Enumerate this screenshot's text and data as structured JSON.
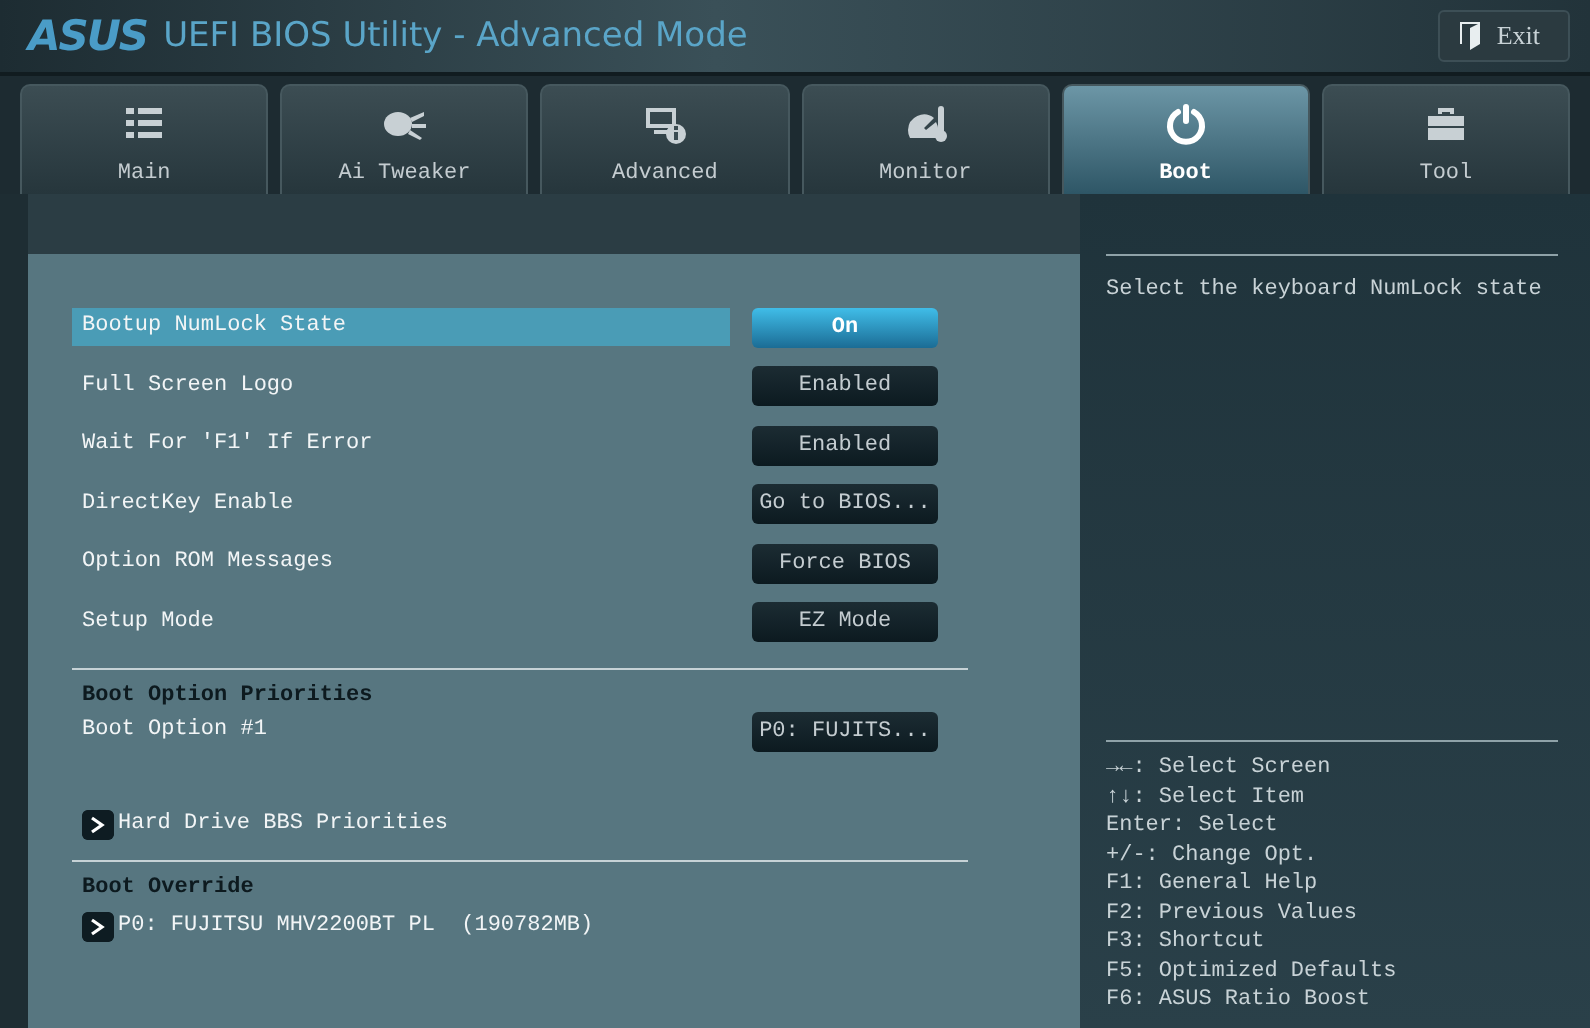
{
  "header": {
    "logo": "ASUS",
    "title": "UEFI BIOS Utility - Advanced Mode",
    "exit_label": "Exit"
  },
  "tabs": [
    {
      "label": "Main",
      "kind": "list",
      "selected": false
    },
    {
      "label": "Ai Tweaker",
      "kind": "fan",
      "selected": false
    },
    {
      "label": "Advanced",
      "kind": "monitor",
      "selected": false
    },
    {
      "label": "Monitor",
      "kind": "gauge",
      "selected": false
    },
    {
      "label": "Boot",
      "kind": "power",
      "selected": true
    },
    {
      "label": "Tool",
      "kind": "toolbox",
      "selected": false
    }
  ],
  "sections": [
    {
      "items": [
        {
          "kind": "option",
          "label": "Bootup NumLock State",
          "value": "On",
          "selected": true
        },
        {
          "kind": "option",
          "label": "Full Screen Logo",
          "value": "Enabled",
          "selected": false
        },
        {
          "kind": "option",
          "label": "Wait For 'F1' If Error",
          "value": "Enabled",
          "selected": false
        },
        {
          "kind": "option",
          "label": "DirectKey Enable",
          "value": "Go to BIOS...",
          "selected": false
        },
        {
          "kind": "option",
          "label": "Option ROM Messages",
          "value": "Force BIOS",
          "selected": false
        },
        {
          "kind": "option",
          "label": "Setup Mode",
          "value": "EZ Mode",
          "selected": false
        }
      ]
    },
    {
      "title": "Boot Option Priorities",
      "items": [
        {
          "kind": "option",
          "label": "Boot Option #1",
          "value": "P0: FUJITS...",
          "selected": false
        },
        {
          "kind": "submenu",
          "label": "Hard Drive BBS Priorities",
          "selected": false
        }
      ]
    },
    {
      "title": "Boot Override",
      "items": [
        {
          "kind": "submenu",
          "label": "P0: FUJITSU MHV2200BT PL  (190782MB)",
          "selected": false
        }
      ]
    }
  ],
  "help": {
    "description": "Select the keyboard NumLock state",
    "keys": [
      "→←: Select Screen",
      "↑↓: Select Item",
      "Enter: Select",
      "+/-: Change Opt.",
      "F1: General Help",
      "F2: Previous Values",
      "F3: Shortcut",
      "F5: Optimized Defaults",
      "F6: ASUS Ratio Boost"
    ]
  }
}
